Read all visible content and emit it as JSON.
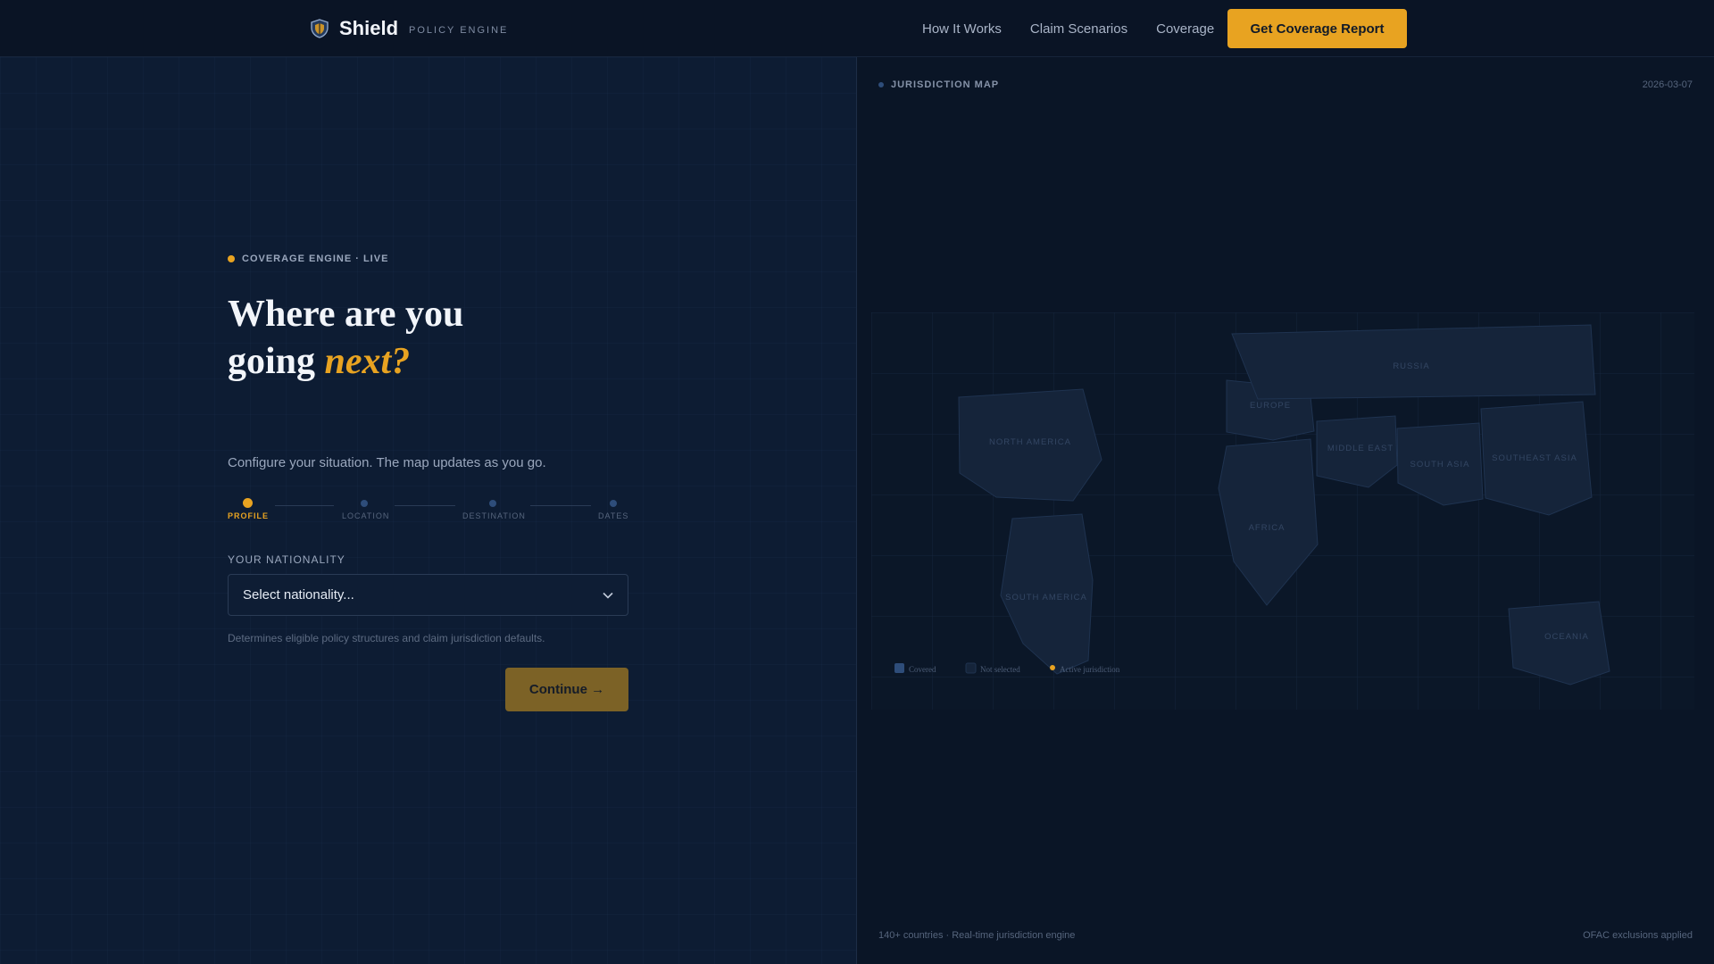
{
  "nav": {
    "brand_name": "Shield",
    "brand_sub": "POLICY ENGINE",
    "links": [
      "How It Works",
      "Claim Scenarios",
      "Coverage"
    ],
    "cta": "Get Coverage Report"
  },
  "hero": {
    "badge": "COVERAGE ENGINE · LIVE",
    "headline_line1": "Where are you",
    "headline_line2_prefix": "going ",
    "headline_accent": "next?",
    "subtitle": "Configure your situation. The map updates as you go."
  },
  "stepper": {
    "steps": [
      "PROFILE",
      "LOCATION",
      "DESTINATION",
      "DATES"
    ],
    "active_index": 0
  },
  "form": {
    "nationality_label": "YOUR NATIONALITY",
    "nationality_value": "Select nationality...",
    "hint": "Determines eligible policy structures and claim jurisdiction defaults.",
    "continue_label": "Continue →"
  },
  "map": {
    "title": "JURISDICTION MAP",
    "date": "2026-03-07",
    "regions": [
      "NORTH AMERICA",
      "SOUTH AMERICA",
      "EUROPE",
      "RUSSIA",
      "MIDDLE EAST",
      "AFRICA",
      "SOUTH ASIA",
      "SOUTHEAST ASIA",
      "OCEANIA"
    ],
    "legend": {
      "covered": "Covered",
      "not_selected": "Not selected",
      "active": "Active jurisdiction"
    },
    "footer_left": "140+ countries · Real-time jurisdiction engine",
    "footer_right": "OFAC exclusions applied"
  },
  "colors": {
    "accent": "#e8a321",
    "background": "#0b1628",
    "panel_right": "#0a1526",
    "region_fill": "#15243a",
    "covered": "#2e4d7a"
  },
  "icons": {
    "brand": "shield-icon",
    "select": "chevron-down-icon"
  }
}
